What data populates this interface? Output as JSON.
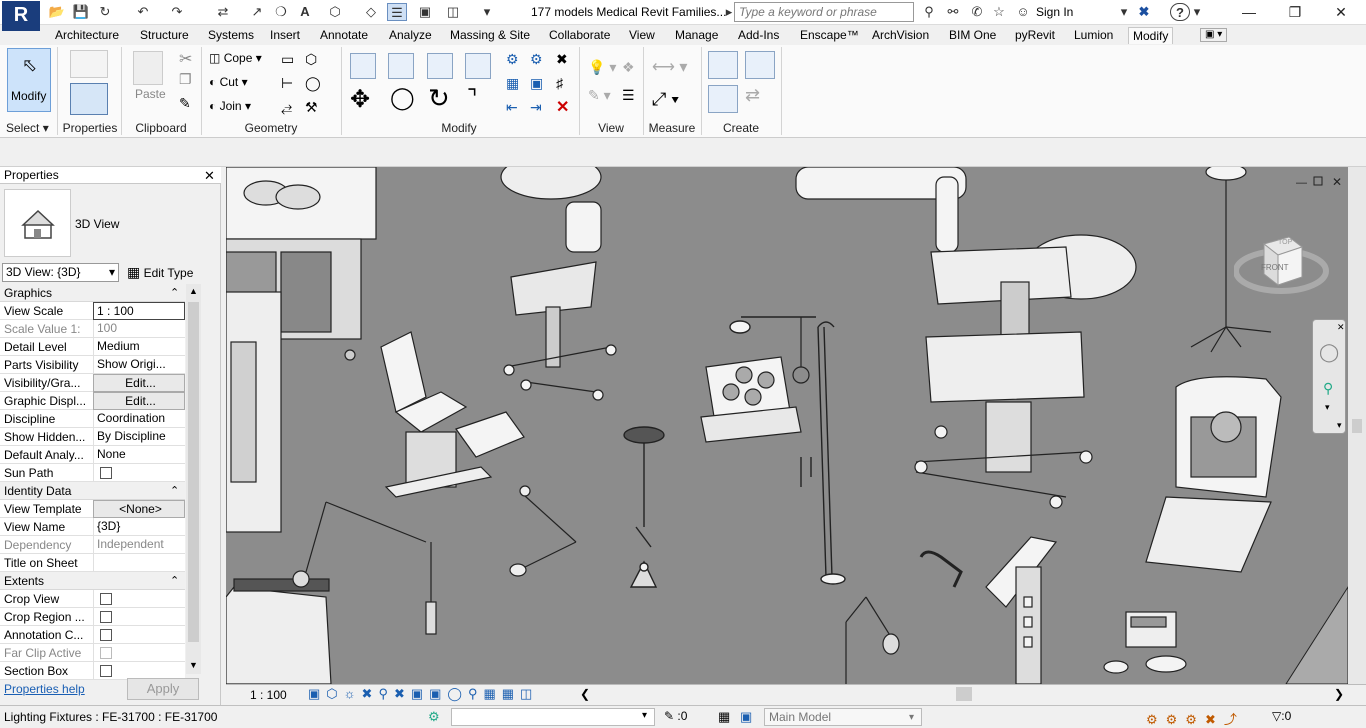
{
  "titlebar": {
    "app_logo": "R",
    "document_title": "177 models Medical Revit Families...",
    "search_placeholder": "Type a keyword or phrase",
    "sign_in": "Sign In",
    "help": "?"
  },
  "tabs": [
    "Architecture",
    "Structure",
    "Systems",
    "Insert",
    "Annotate",
    "Analyze",
    "Massing & Site",
    "Collaborate",
    "View",
    "Manage",
    "Add-Ins",
    "Enscape™",
    "ArchVision",
    "BIM One",
    "pyRevit",
    "Lumion",
    "Modify"
  ],
  "active_tab": "Modify",
  "ribbon": {
    "modify_label": "Modify",
    "paste_label": "Paste",
    "cope_label": "Cope",
    "cut_label": "Cut",
    "join_label": "Join",
    "panels": {
      "select": "Select",
      "properties": "Properties",
      "clipboard": "Clipboard",
      "geometry": "Geometry",
      "modify": "Modify",
      "view": "View",
      "measure": "Measure",
      "create": "Create"
    }
  },
  "properties": {
    "title": "Properties",
    "type_name": "3D View",
    "view_selector": "3D View: {3D}",
    "edit_type": "Edit Type",
    "groups": {
      "graphics": "Graphics",
      "identity": "Identity Data",
      "extents": "Extents"
    },
    "rows": {
      "view_scale": {
        "k": "View Scale",
        "v": "1 : 100"
      },
      "scale_value": {
        "k": "Scale Value    1:",
        "v": "100"
      },
      "detail_level": {
        "k": "Detail Level",
        "v": "Medium"
      },
      "parts_visibility": {
        "k": "Parts Visibility",
        "v": "Show Origi..."
      },
      "visibility_graphics": {
        "k": "Visibility/Gra...",
        "v": "Edit..."
      },
      "graphic_display": {
        "k": "Graphic Displ...",
        "v": "Edit..."
      },
      "discipline": {
        "k": "Discipline",
        "v": "Coordination"
      },
      "show_hidden": {
        "k": "Show Hidden...",
        "v": "By Discipline"
      },
      "default_analysis": {
        "k": "Default Analy...",
        "v": "None"
      },
      "sun_path": {
        "k": "Sun Path",
        "v": ""
      },
      "view_template": {
        "k": "View Template",
        "v": "<None>"
      },
      "view_name": {
        "k": "View Name",
        "v": "{3D}"
      },
      "dependency": {
        "k": "Dependency",
        "v": "Independent"
      },
      "title_on_sheet": {
        "k": "Title on Sheet",
        "v": ""
      },
      "crop_view": {
        "k": "Crop View",
        "v": ""
      },
      "crop_region": {
        "k": "Crop Region ...",
        "v": ""
      },
      "annotation_crop": {
        "k": "Annotation C...",
        "v": ""
      },
      "far_clip": {
        "k": "Far Clip Active",
        "v": ""
      },
      "section_box": {
        "k": "Section Box",
        "v": ""
      }
    },
    "help_link": "Properties help",
    "apply": "Apply"
  },
  "viewport": {
    "viewcube_top": "TOP",
    "viewcube_front": "FRONT"
  },
  "viewbar": {
    "scale": "1 : 100"
  },
  "statusbar": {
    "selection": "Lighting Fixtures : FE-31700 : FE-31700",
    "count": ":0",
    "main_model": "Main Model",
    "filter_count": ":0"
  }
}
